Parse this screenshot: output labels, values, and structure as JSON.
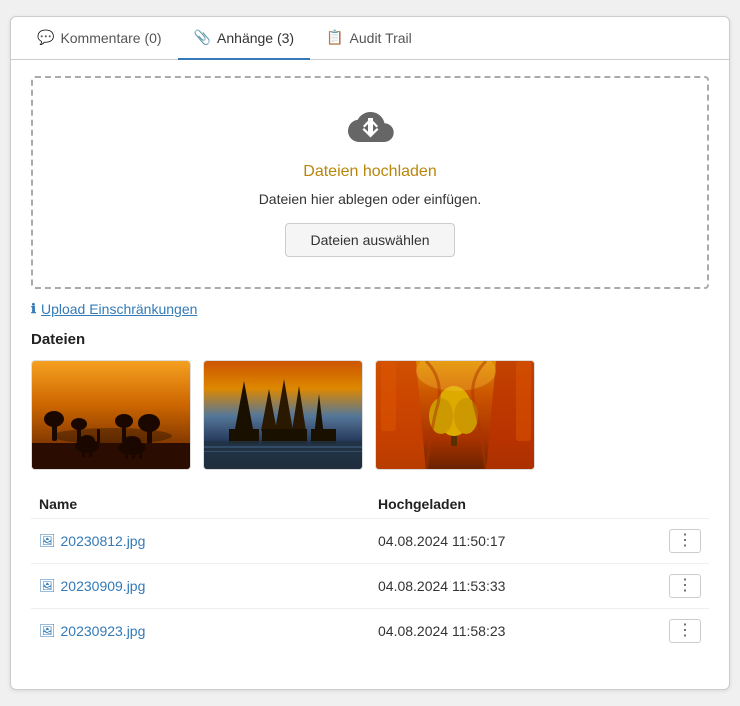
{
  "tabs": [
    {
      "id": "kommentare",
      "label": "Kommentare (0)",
      "icon": "💬",
      "active": false
    },
    {
      "id": "anhaenge",
      "label": "Anhänge (3)",
      "icon": "📎",
      "active": true
    },
    {
      "id": "audit-trail",
      "label": "Audit Trail",
      "icon": "📋",
      "active": false
    }
  ],
  "upload": {
    "title": "Dateien hochladen",
    "hint": "Dateien hier ablegen oder einfügen.",
    "button_label": "Dateien auswählen"
  },
  "restrictions_link": "Upload Einschränkungen",
  "files_label": "Dateien",
  "table": {
    "col_name": "Name",
    "col_uploaded": "Hochgeladen",
    "rows": [
      {
        "name": "20230812.jpg",
        "uploaded": "04.08.2024 11:50:17"
      },
      {
        "name": "20230909.jpg",
        "uploaded": "04.08.2024 11:53:33"
      },
      {
        "name": "20230923.jpg",
        "uploaded": "04.08.2024 11:58:23"
      }
    ]
  }
}
